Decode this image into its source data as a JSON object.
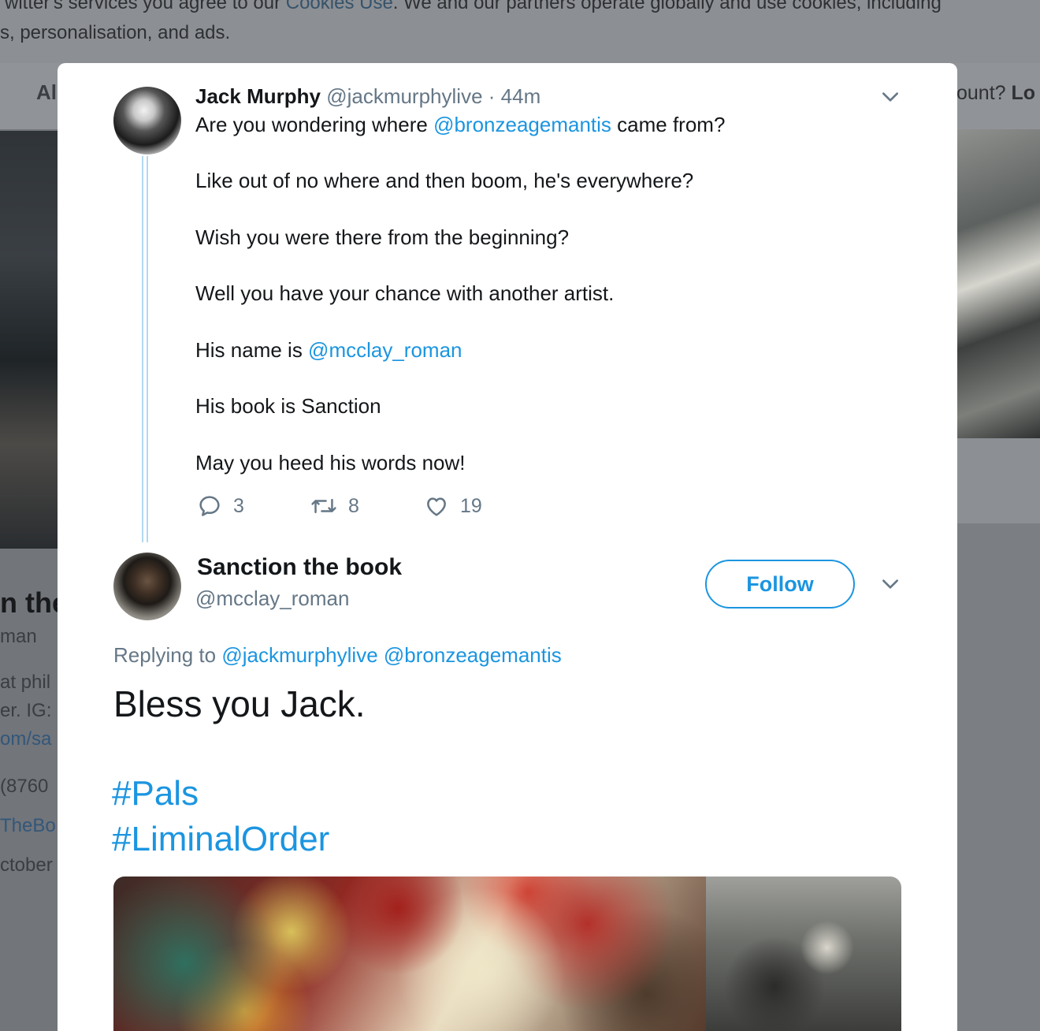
{
  "background": {
    "cookie_line1_prefix": "witter's services you agree to our",
    "cookie_link": "Cookies Use",
    "cookie_line1_suffix": ". We and our partners operate globally and use cookies, including",
    "cookie_line2": "s, personalisation, and ads.",
    "nav_left": "Al",
    "nav_right_prefix": "ount?",
    "nav_right_link": "Lo",
    "profile_fragments": {
      "name": "n the",
      "handle": "man",
      "bio1": "at phil",
      "bio2": "er. IG:",
      "bio_link": "om/sa",
      "phone": "(8760",
      "website": "TheBo",
      "joined": "ctober"
    }
  },
  "tweet": {
    "author_name": "Jack Murphy",
    "author_handle": "@jackmurphylive",
    "separator": "·",
    "time": "44m",
    "lines": {
      "l1_prefix": "Are you wondering where ",
      "l1_mention": "@bronzeagemantis",
      "l1_suffix": " came from?",
      "l2": "Like out of no where and then boom, he's everywhere?",
      "l3": "Wish you were there from the beginning?",
      "l4": "Well you have your chance with another artist.",
      "l5_prefix": "His name is ",
      "l5_mention": "@mcclay_roman",
      "l6": "His book is Sanction",
      "l7": "May you heed his words now!"
    },
    "replies_count": "3",
    "retweets_count": "8",
    "likes_count": "19"
  },
  "reply": {
    "author_name": "Sanction the book",
    "author_handle": "@mcclay_roman",
    "follow_label": "Follow",
    "replying_prefix": "Replying to",
    "replying_to_1": "@jackmurphylive",
    "replying_to_2": "@bronzeagemantis",
    "text": "Bless you Jack.",
    "hashtag_1": "#Pals",
    "hashtag_2": "#LiminalOrder"
  },
  "icons": {
    "reply": "reply-icon",
    "retweet": "retweet-icon",
    "like": "heart-icon",
    "more": "chevron-down-icon"
  },
  "colors": {
    "link": "#1b95e0",
    "secondary_text": "#657786",
    "thread_line": "#b3d8f1"
  }
}
